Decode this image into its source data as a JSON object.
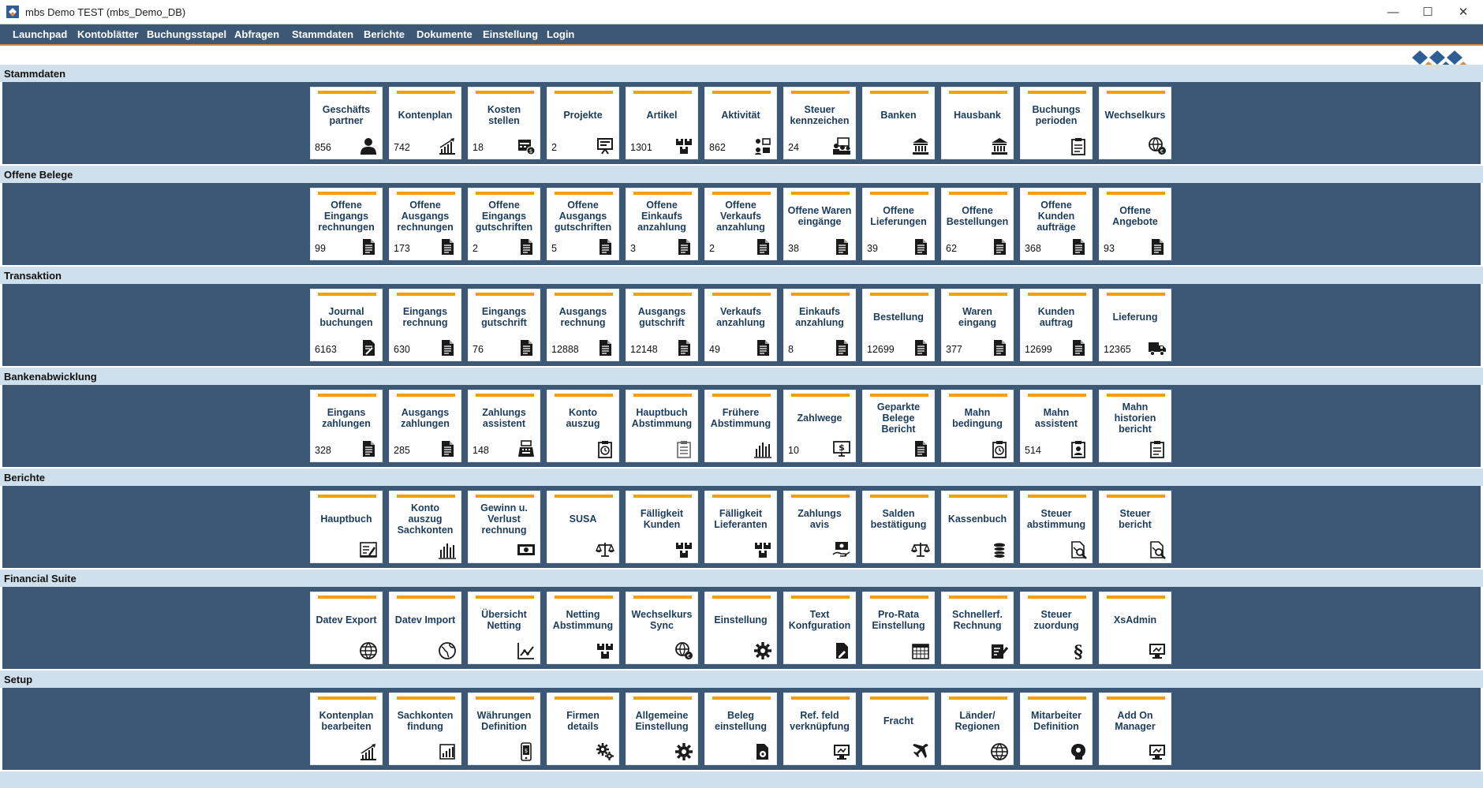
{
  "window": {
    "title": "mbs Demo TEST (mbs_Demo_DB)",
    "minimize_glyph": "—",
    "maximize_glyph": "☐",
    "close_glyph": "✕"
  },
  "menu": [
    {
      "label": "Launchpad"
    },
    {
      "label": "Kontoblätter"
    },
    {
      "label": "Buchungsstapel"
    },
    {
      "label": "Abfragen"
    },
    {
      "label": "Stammdaten"
    },
    {
      "label": "Berichte"
    },
    {
      "label": "Dokumente"
    },
    {
      "label": "Einstellung"
    },
    {
      "label": "Login"
    }
  ],
  "colors": {
    "menu_background": "#3d5875",
    "accent_orange": "#f5a000",
    "section_header_background": "#cfe0ec",
    "tile_text": "#1c3c5c",
    "logo_blue": "#2d5f96",
    "logo_orange": "#e8892a"
  },
  "sections": [
    {
      "title": "Stammdaten",
      "tiles": [
        {
          "label": "Geschäfts\npartner",
          "count": "856",
          "icon": "person-icon"
        },
        {
          "label": "Kontenplan",
          "count": "742",
          "icon": "chart-up-icon"
        },
        {
          "label": "Kosten\nstellen",
          "count": "18",
          "icon": "calendar-money-icon"
        },
        {
          "label": "Projekte",
          "count": "2",
          "icon": "presentation-icon"
        },
        {
          "label": "Artikel",
          "count": "1301",
          "icon": "boxes-icon"
        },
        {
          "label": "Aktivität",
          "count": "862",
          "icon": "activity-icon"
        },
        {
          "label": "Steuer\nkennzeichen",
          "count": "24",
          "icon": "people-board-icon"
        },
        {
          "label": "Banken",
          "count": "",
          "icon": "bank-icon"
        },
        {
          "label": "Hausbank",
          "count": "",
          "icon": "bank-icon"
        },
        {
          "label": "Buchungs\nperioden",
          "count": "",
          "icon": "clipboard-icon"
        },
        {
          "label": "Wechselkurs",
          "count": "",
          "icon": "globe-currency-icon"
        }
      ]
    },
    {
      "title": "Offene Belege",
      "tiles": [
        {
          "label": "Offene\nEingangs\nrechnungen",
          "count": "99",
          "icon": "document-icon"
        },
        {
          "label": "Offene\nAusgangs\nrechnungen",
          "count": "173",
          "icon": "document-icon"
        },
        {
          "label": "Offene\nEingangs\ngutschriften",
          "count": "2",
          "icon": "document-icon"
        },
        {
          "label": "Offene\nAusgangs\ngutschriften",
          "count": "5",
          "icon": "document-icon"
        },
        {
          "label": "Offene\nEinkaufs\nanzahlung",
          "count": "3",
          "icon": "document-icon"
        },
        {
          "label": "Offene\nVerkaufs\nanzahlung",
          "count": "2",
          "icon": "document-icon"
        },
        {
          "label": "Offene Waren\neingänge",
          "count": "38",
          "icon": "document-icon"
        },
        {
          "label": "Offene\nLieferungen",
          "count": "39",
          "icon": "document-icon"
        },
        {
          "label": "Offene\nBestellungen",
          "count": "62",
          "icon": "document-icon"
        },
        {
          "label": "Offene\nKunden\naufträge",
          "count": "368",
          "icon": "document-icon"
        },
        {
          "label": "Offene\nAngebote",
          "count": "93",
          "icon": "document-icon"
        }
      ]
    },
    {
      "title": "Transaktion",
      "tiles": [
        {
          "label": "Journal\nbuchungen",
          "count": "6163",
          "icon": "journal-icon"
        },
        {
          "label": "Eingangs\nrechnung",
          "count": "630",
          "icon": "document-icon"
        },
        {
          "label": "Eingangs\ngutschrift",
          "count": "76",
          "icon": "document-icon"
        },
        {
          "label": "Ausgangs\nrechnung",
          "count": "12888",
          "icon": "document-icon"
        },
        {
          "label": "Ausgangs\ngutschrift",
          "count": "12148",
          "icon": "document-icon"
        },
        {
          "label": "Verkaufs\nanzahlung",
          "count": "49",
          "icon": "document-icon"
        },
        {
          "label": "Einkaufs\nanzahlung",
          "count": "8",
          "icon": "document-icon"
        },
        {
          "label": "Bestellung",
          "count": "12699",
          "icon": "document-icon"
        },
        {
          "label": "Waren\neingang",
          "count": "377",
          "icon": "document-icon"
        },
        {
          "label": "Kunden\nauftrag",
          "count": "12699",
          "icon": "document-icon"
        },
        {
          "label": "Lieferung",
          "count": "12365",
          "icon": "truck-icon"
        }
      ]
    },
    {
      "title": "Bankenabwicklung",
      "tiles": [
        {
          "label": "Eingans\nzahlungen",
          "count": "328",
          "icon": "document-icon"
        },
        {
          "label": "Ausgangs\nzahlungen",
          "count": "285",
          "icon": "document-icon"
        },
        {
          "label": "Zahlungs\nassistent",
          "count": "148",
          "icon": "cash-register-icon"
        },
        {
          "label": "Konto\nauszug",
          "count": "",
          "icon": "clipboard-clock-icon"
        },
        {
          "label": "Hauptbuch\nAbstimmung",
          "count": "",
          "icon": "clipboard-list-icon"
        },
        {
          "label": "Frühere\nAbstimmung",
          "count": "",
          "icon": "bar-chart-icon"
        },
        {
          "label": "Zahlwege",
          "count": "10",
          "icon": "money-screen-icon"
        },
        {
          "label": "Geparkte\nBelege\nBericht",
          "count": "",
          "icon": "document-icon"
        },
        {
          "label": "Mahn\nbedingung",
          "count": "",
          "icon": "clipboard-clock-icon"
        },
        {
          "label": "Mahn\nassistent",
          "count": "514",
          "icon": "clipboard-person-icon"
        },
        {
          "label": "Mahn\nhistorien\nbericht",
          "count": "",
          "icon": "clipboard-icon"
        }
      ]
    },
    {
      "title": "Berichte",
      "tiles": [
        {
          "label": "Hauptbuch",
          "count": "",
          "icon": "ledger-icon"
        },
        {
          "label": "Konto\nauszug\nSachkonten",
          "count": "",
          "icon": "bar-chart-icon"
        },
        {
          "label": "Gewinn u.\nVerlust\nrechnung",
          "count": "",
          "icon": "money-bill-icon"
        },
        {
          "label": "SUSA",
          "count": "",
          "icon": "scale-icon"
        },
        {
          "label": "Fälligkeit\nKunden",
          "count": "",
          "icon": "boxes-icon"
        },
        {
          "label": "Fälligkeit\nLieferanten",
          "count": "",
          "icon": "boxes-icon"
        },
        {
          "label": "Zahlungs\navis",
          "count": "",
          "icon": "money-hand-icon"
        },
        {
          "label": "Salden\nbestätigung",
          "count": "",
          "icon": "scale-icon"
        },
        {
          "label": "Kassenbuch",
          "count": "",
          "icon": "coins-icon"
        },
        {
          "label": "Steuer\nabstimmung",
          "count": "",
          "icon": "document-search-icon"
        },
        {
          "label": "Steuer\nbericht",
          "count": "",
          "icon": "document-search-icon"
        }
      ]
    },
    {
      "title": "Financial Suite",
      "tiles": [
        {
          "label": "Datev Export",
          "count": "",
          "icon": "globe-icon"
        },
        {
          "label": "Datev Import",
          "count": "",
          "icon": "globe-outline-icon"
        },
        {
          "label": "Übersicht\nNetting",
          "count": "",
          "icon": "trend-icon"
        },
        {
          "label": "Netting\nAbstimmung",
          "count": "",
          "icon": "boxes-icon"
        },
        {
          "label": "Wechselkurs\nSync",
          "count": "",
          "icon": "globe-currency-icon"
        },
        {
          "label": "Einstellung",
          "count": "",
          "icon": "gear-icon"
        },
        {
          "label": "Text\nKonfguration",
          "count": "",
          "icon": "document-edit-icon"
        },
        {
          "label": "Pro-Rata\nEinstellung",
          "count": "",
          "icon": "calendar-grid-icon"
        },
        {
          "label": "Schnellerf.\nRechnung",
          "count": "",
          "icon": "pen-paper-icon"
        },
        {
          "label": "Steuer\nzuordung",
          "count": "",
          "icon": "paragraph-icon"
        },
        {
          "label": "XsAdmin",
          "count": "",
          "icon": "monitor-icon"
        }
      ]
    },
    {
      "title": "Setup",
      "tiles": [
        {
          "label": "Kontenplan\nbearbeiten",
          "count": "",
          "icon": "chart-up-icon"
        },
        {
          "label": "Sachkonten\nfindung",
          "count": "",
          "icon": "chart-board-icon"
        },
        {
          "label": "Währungen\nDefinition",
          "count": "",
          "icon": "phone-money-icon"
        },
        {
          "label": "Firmen\ndetails",
          "count": "",
          "icon": "gears-icon"
        },
        {
          "label": "Allgemeine\nEinstellung",
          "count": "",
          "icon": "gear-icon"
        },
        {
          "label": "Beleg\neinstellung",
          "count": "",
          "icon": "document-gear-icon"
        },
        {
          "label": "Ref. feld\nverknüpfung",
          "count": "",
          "icon": "monitor-icon"
        },
        {
          "label": "Fracht",
          "count": "",
          "icon": "airplane-icon"
        },
        {
          "label": "Länder/\nRegionen",
          "count": "",
          "icon": "globe-icon"
        },
        {
          "label": "Mitarbeiter\nDefinition",
          "count": "",
          "icon": "person-head-icon"
        },
        {
          "label": "Add On\nManager",
          "count": "",
          "icon": "monitor-icon"
        }
      ]
    }
  ]
}
